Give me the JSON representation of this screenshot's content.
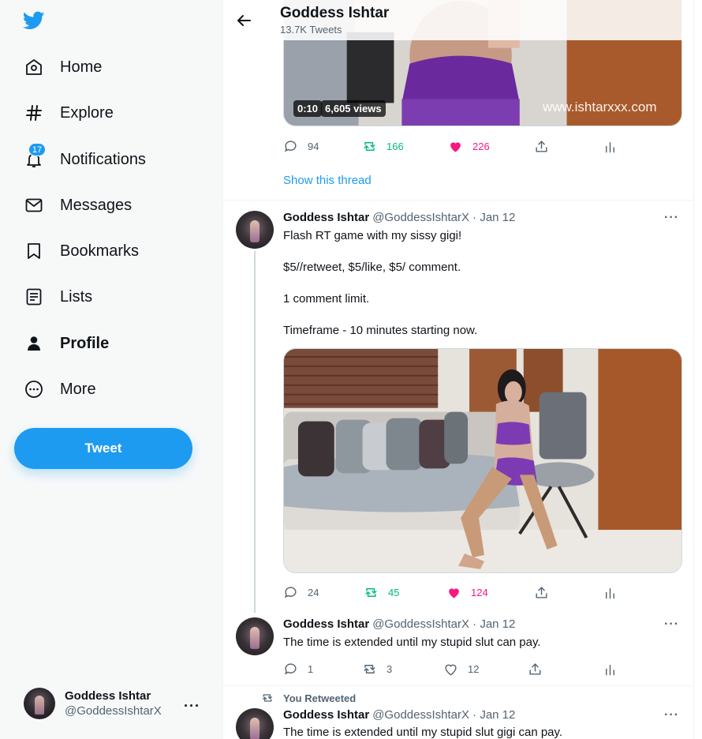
{
  "colors": {
    "accent": "#1d9bf0",
    "retweet": "#00ba7c",
    "like": "#f91880",
    "muted": "#536471"
  },
  "nav": {
    "logo_icon": "twitter-bird-icon",
    "items": [
      {
        "id": "home",
        "label": "Home",
        "icon": "home-icon"
      },
      {
        "id": "explore",
        "label": "Explore",
        "icon": "hashtag-icon"
      },
      {
        "id": "notifications",
        "label": "Notifications",
        "icon": "bell-icon",
        "badge": "17"
      },
      {
        "id": "messages",
        "label": "Messages",
        "icon": "envelope-icon"
      },
      {
        "id": "bookmarks",
        "label": "Bookmarks",
        "icon": "bookmark-icon"
      },
      {
        "id": "lists",
        "label": "Lists",
        "icon": "list-icon"
      },
      {
        "id": "profile",
        "label": "Profile",
        "icon": "person-icon",
        "active": true
      },
      {
        "id": "more",
        "label": "More",
        "icon": "more-circle-icon"
      }
    ],
    "tweet_button": "Tweet"
  },
  "account": {
    "name": "Goddess Ishtar",
    "handle": "@GoddessIshtarX",
    "more": "···"
  },
  "header": {
    "title": "Goddess Ishtar",
    "subtitle": "13.7K Tweets"
  },
  "tweet1": {
    "video_time": "0:10",
    "video_views": "6,605 views",
    "watermark": "www.ishtarxxx.com",
    "replies": "94",
    "retweets": "166",
    "likes": "226",
    "show_thread": "Show this thread"
  },
  "tweet2": {
    "name": "Goddess Ishtar",
    "handle_date": "@GoddessIshtarX · Jan 12",
    "more": "···",
    "lines": [
      "Flash RT game with my sissy gigi!",
      "$5//retweet, $5/like, $5/ comment.",
      "1 comment limit.",
      "Timeframe - 10 minutes starting now."
    ],
    "replies": "24",
    "retweets": "45",
    "likes": "124"
  },
  "tweet3": {
    "name": "Goddess Ishtar",
    "handle_date": "@GoddessIshtarX · Jan 12",
    "more": "···",
    "text": "The time is extended until my stupid slut can pay.",
    "replies": "1",
    "retweets": "3",
    "likes": "12"
  },
  "tweet4": {
    "retweet_label": "You Retweeted",
    "name": "Goddess Ishtar",
    "handle_date": "@GoddessIshtarX · Jan 12",
    "more": "···",
    "text": "The time is extended until my stupid slut gigi can pay."
  }
}
